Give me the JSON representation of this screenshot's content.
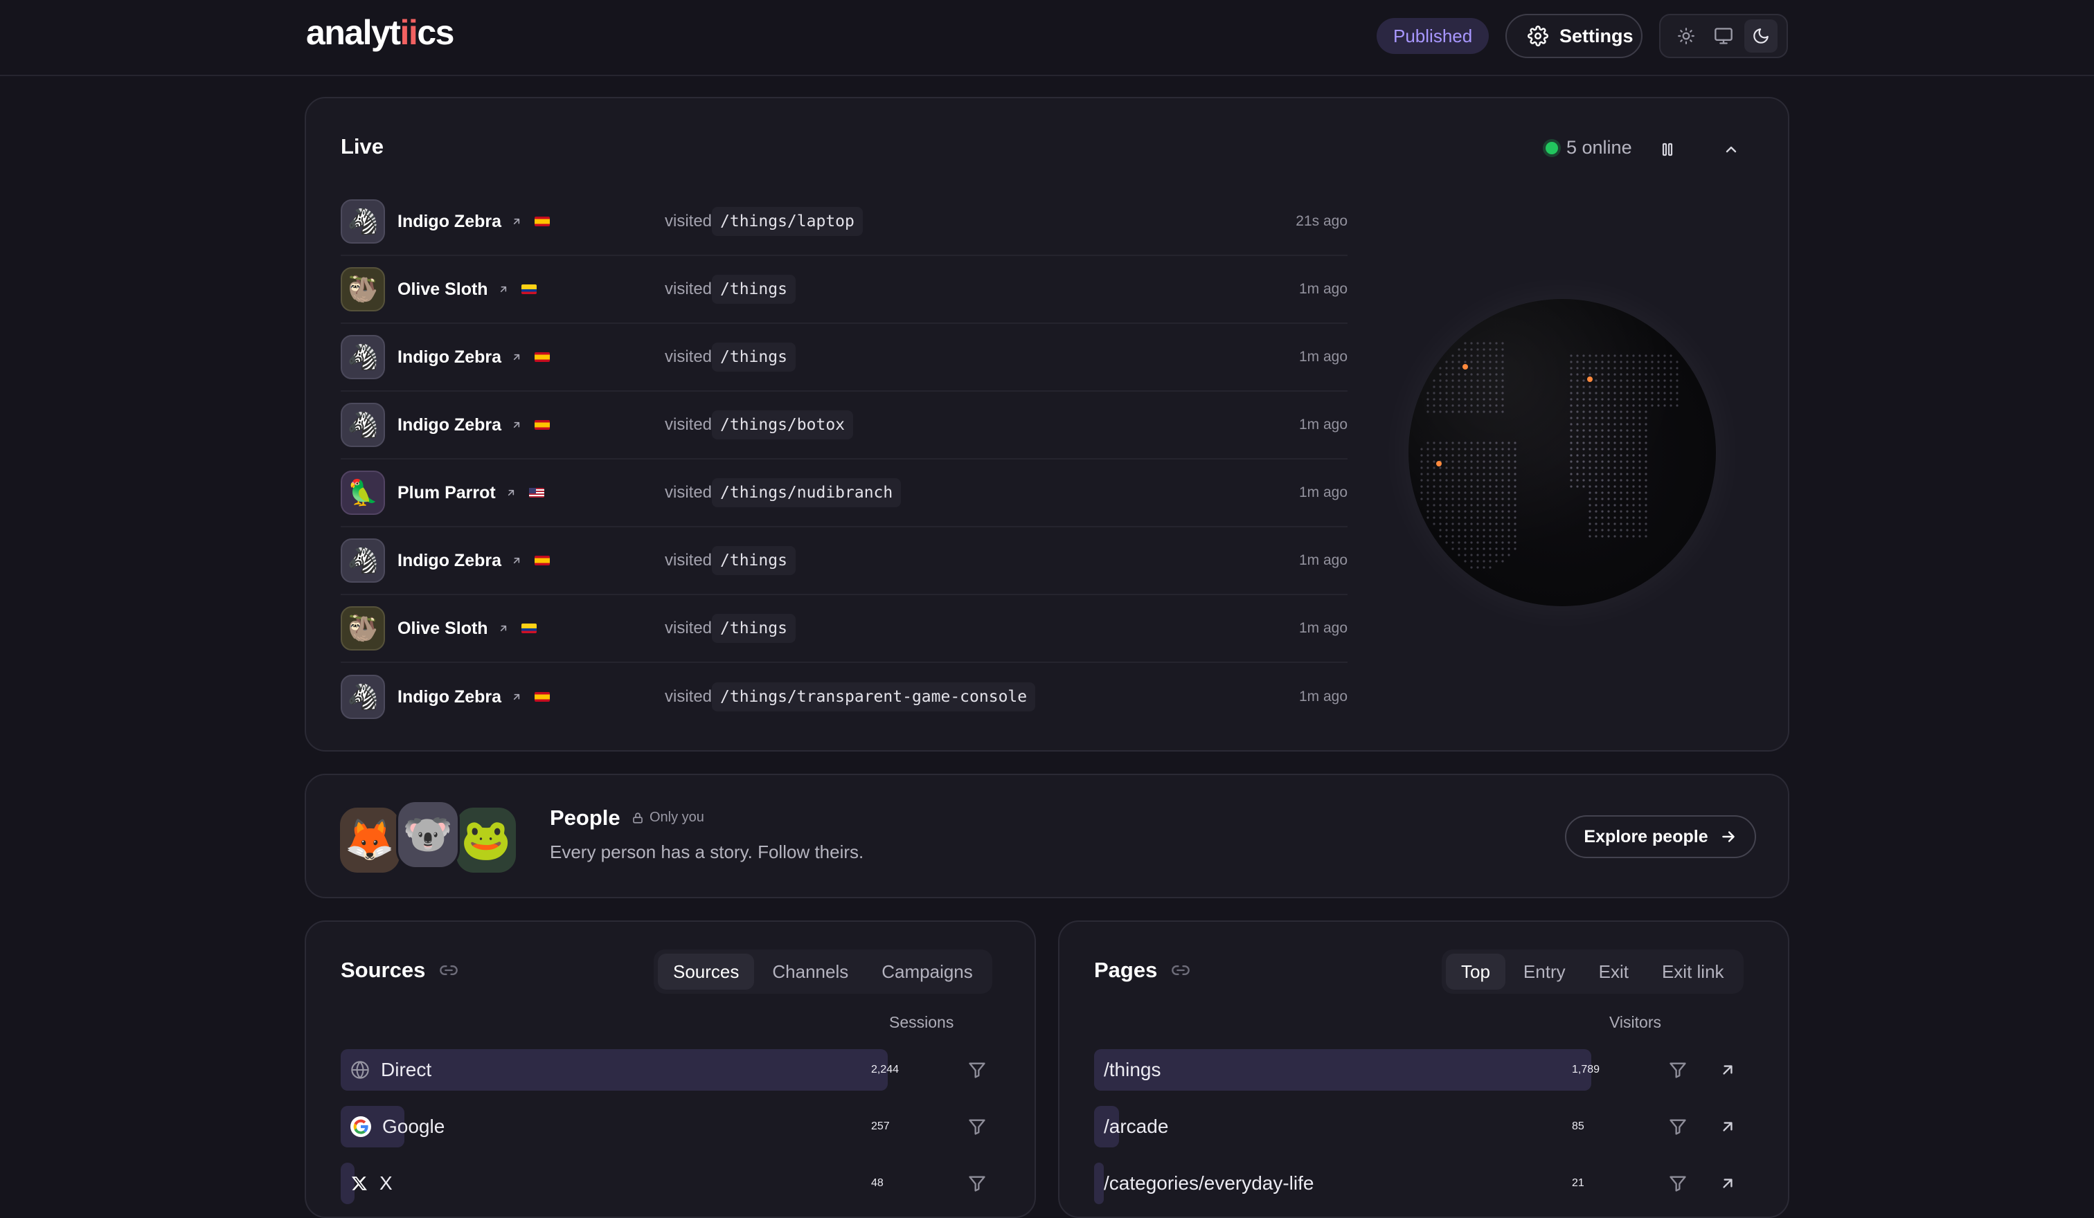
{
  "header": {
    "logo_pre": "analyt",
    "logo_ii": "ii",
    "logo_post": "cs",
    "published_label": "Published",
    "settings_label": "Settings"
  },
  "live": {
    "title": "Live",
    "online_text": "5 online",
    "visited_word": "visited",
    "events": [
      {
        "name": "Indigo Zebra",
        "avatar": "🦓",
        "flag": "es",
        "path": "/things/laptop",
        "ago": "21s ago"
      },
      {
        "name": "Olive Sloth",
        "avatar": "🦥",
        "flag": "co",
        "path": "/things",
        "ago": "1m ago"
      },
      {
        "name": "Indigo Zebra",
        "avatar": "🦓",
        "flag": "es",
        "path": "/things",
        "ago": "1m ago"
      },
      {
        "name": "Indigo Zebra",
        "avatar": "🦓",
        "flag": "es",
        "path": "/things/botox",
        "ago": "1m ago"
      },
      {
        "name": "Plum Parrot",
        "avatar": "🦜",
        "flag": "us",
        "path": "/things/nudibranch",
        "ago": "1m ago"
      },
      {
        "name": "Indigo Zebra",
        "avatar": "🦓",
        "flag": "es",
        "path": "/things",
        "ago": "1m ago"
      },
      {
        "name": "Olive Sloth",
        "avatar": "🦥",
        "flag": "co",
        "path": "/things",
        "ago": "1m ago"
      },
      {
        "name": "Indigo Zebra",
        "avatar": "🦓",
        "flag": "es",
        "path": "/things/transparent-game-console",
        "ago": "1m ago"
      }
    ]
  },
  "people": {
    "title": "People",
    "badge": "Only you",
    "subtitle": "Every person has a story. Follow theirs.",
    "explore_label": "Explore people",
    "avatars": [
      "🦊",
      "🐨",
      "🐸"
    ]
  },
  "sources": {
    "title": "Sources",
    "tabs": [
      "Sources",
      "Channels",
      "Campaigns"
    ],
    "active_tab": "Sources",
    "column": "Sessions",
    "rows": [
      {
        "label": "Direct",
        "icon": "globe-icon",
        "value": "2,244",
        "share": 1.0
      },
      {
        "label": "Google",
        "icon": "google-icon",
        "value": "257",
        "share": 0.115
      },
      {
        "label": "X",
        "icon": "x-icon",
        "value": "48",
        "share": 0.021
      }
    ]
  },
  "pages": {
    "title": "Pages",
    "tabs": [
      "Top",
      "Entry",
      "Exit",
      "Exit link"
    ],
    "active_tab": "Top",
    "column": "Visitors",
    "rows": [
      {
        "label": "/things",
        "value": "1,789",
        "share": 1.0
      },
      {
        "label": "/arcade",
        "value": "85",
        "share": 0.048
      },
      {
        "label": "/categories/everyday-life",
        "value": "21",
        "share": 0.012
      }
    ]
  },
  "colors": {
    "background": "#15141c",
    "card": "#1a1922",
    "accent": "#a897ff",
    "bar": "#2e2a45",
    "online": "#22c55e"
  }
}
